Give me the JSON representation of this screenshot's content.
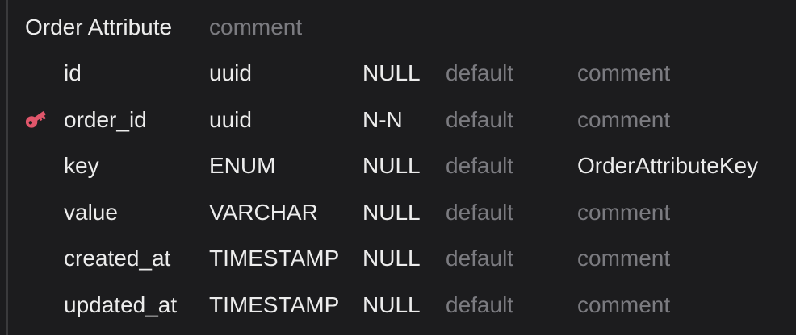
{
  "table": {
    "name": "Order Attribute",
    "comment": "comment"
  },
  "colors": {
    "background": "#1c1c1e",
    "primary_text": "#ececec",
    "muted_text": "#7b7b80",
    "primary_key_icon": "#e0566b"
  },
  "columns": [
    {
      "name": "id",
      "type": "uuid",
      "nullability": "NULL",
      "default": "default",
      "comment": "comment",
      "comment_set": false,
      "primary_key": false
    },
    {
      "name": "order_id",
      "type": "uuid",
      "nullability": "N-N",
      "default": "default",
      "comment": "comment",
      "comment_set": false,
      "primary_key": true,
      "icon": "key-icon"
    },
    {
      "name": "key",
      "type": "ENUM",
      "nullability": "NULL",
      "default": "default",
      "comment": "OrderAttributeKey",
      "comment_set": true,
      "primary_key": false
    },
    {
      "name": "value",
      "type": "VARCHAR",
      "nullability": "NULL",
      "default": "default",
      "comment": "comment",
      "comment_set": false,
      "primary_key": false
    },
    {
      "name": "created_at",
      "type": "TIMESTAMP",
      "nullability": "NULL",
      "default": "default",
      "comment": "comment",
      "comment_set": false,
      "primary_key": false
    },
    {
      "name": "updated_at",
      "type": "TIMESTAMP",
      "nullability": "NULL",
      "default": "default",
      "comment": "comment",
      "comment_set": false,
      "primary_key": false
    }
  ]
}
